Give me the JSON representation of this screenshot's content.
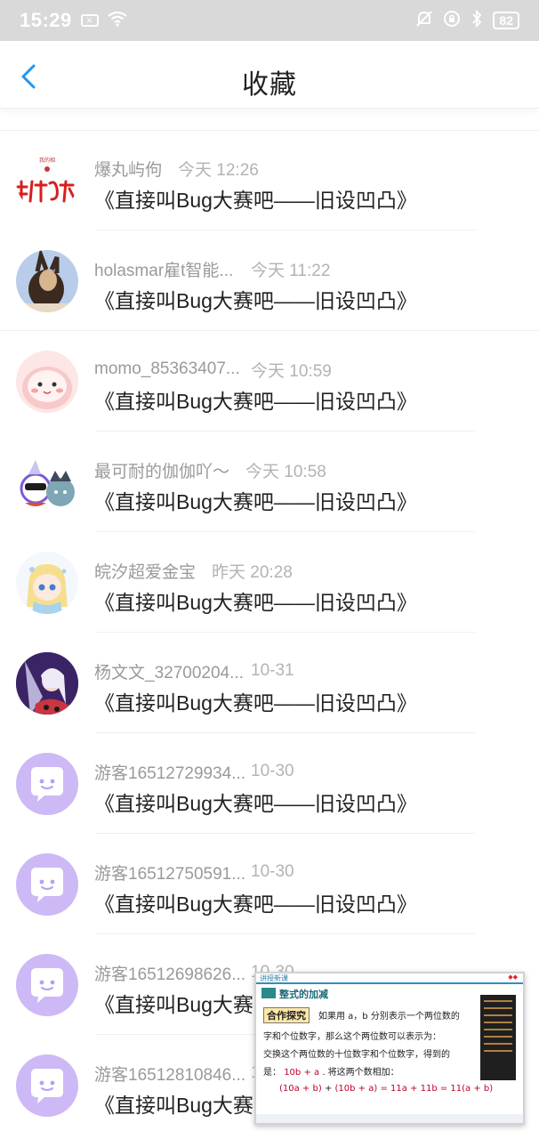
{
  "status_bar": {
    "time": "15:29",
    "battery": "82"
  },
  "header": {
    "title": "收藏"
  },
  "items": [
    {
      "name": "爆丸屿佝",
      "time": "今天 12:26",
      "title": "《直接叫Bug大赛吧——旧设凹凸》",
      "avatar_logo_text": "我的相"
    },
    {
      "name": "holasmar雇t智能...",
      "time": "今天 11:22",
      "title": "《直接叫Bug大赛吧——旧设凹凸》"
    },
    {
      "name": "momo_85363407...",
      "time": "今天 10:59",
      "title": "《直接叫Bug大赛吧——旧设凹凸》"
    },
    {
      "name": "最可耐的伽伽吖～",
      "time": "今天 10:58",
      "title": "《直接叫Bug大赛吧——旧设凹凸》"
    },
    {
      "name": "皖汐超爱金宝",
      "time": "昨天 20:28",
      "title": "《直接叫Bug大赛吧——旧设凹凸》"
    },
    {
      "name": "杨文文_32700204...",
      "time": "10-31",
      "title": "《直接叫Bug大赛吧——旧设凹凸》"
    },
    {
      "name": "游客16512729934...",
      "time": "10-30",
      "title": "《直接叫Bug大赛吧——旧设凹凸》"
    },
    {
      "name": "游客16512750591...",
      "time": "10-30",
      "title": "《直接叫Bug大赛吧——旧设凹凸》"
    },
    {
      "name": "游客16512698626...",
      "time": "10-30",
      "title": "《直接叫Bug大赛吧——旧设凹凸》"
    },
    {
      "name": "游客16512810846...",
      "time": "10-30",
      "title": "《直接叫Bug大赛吧——旧设凹凸》"
    }
  ],
  "overlay": {
    "header": "讲授新课",
    "heading": "整式的加减",
    "label": "合作探究",
    "line1": "如果用 a，b 分别表示一个两位数的",
    "line2": "字和个位数字，那么这个两位数可以表示为：",
    "line3": "交换这个两位数的十位数字和个位数字，得到的",
    "line4_prefix": "是：",
    "line4_answer": "10b + a",
    "line4_suffix": ". 将这两个数相加：",
    "line5_answer1": "(10a + b)",
    "line5_mid": "+",
    "line5_answer2": "(10b + a)",
    "line5_rest": "= 11a + 11b = 11(a + b)"
  }
}
